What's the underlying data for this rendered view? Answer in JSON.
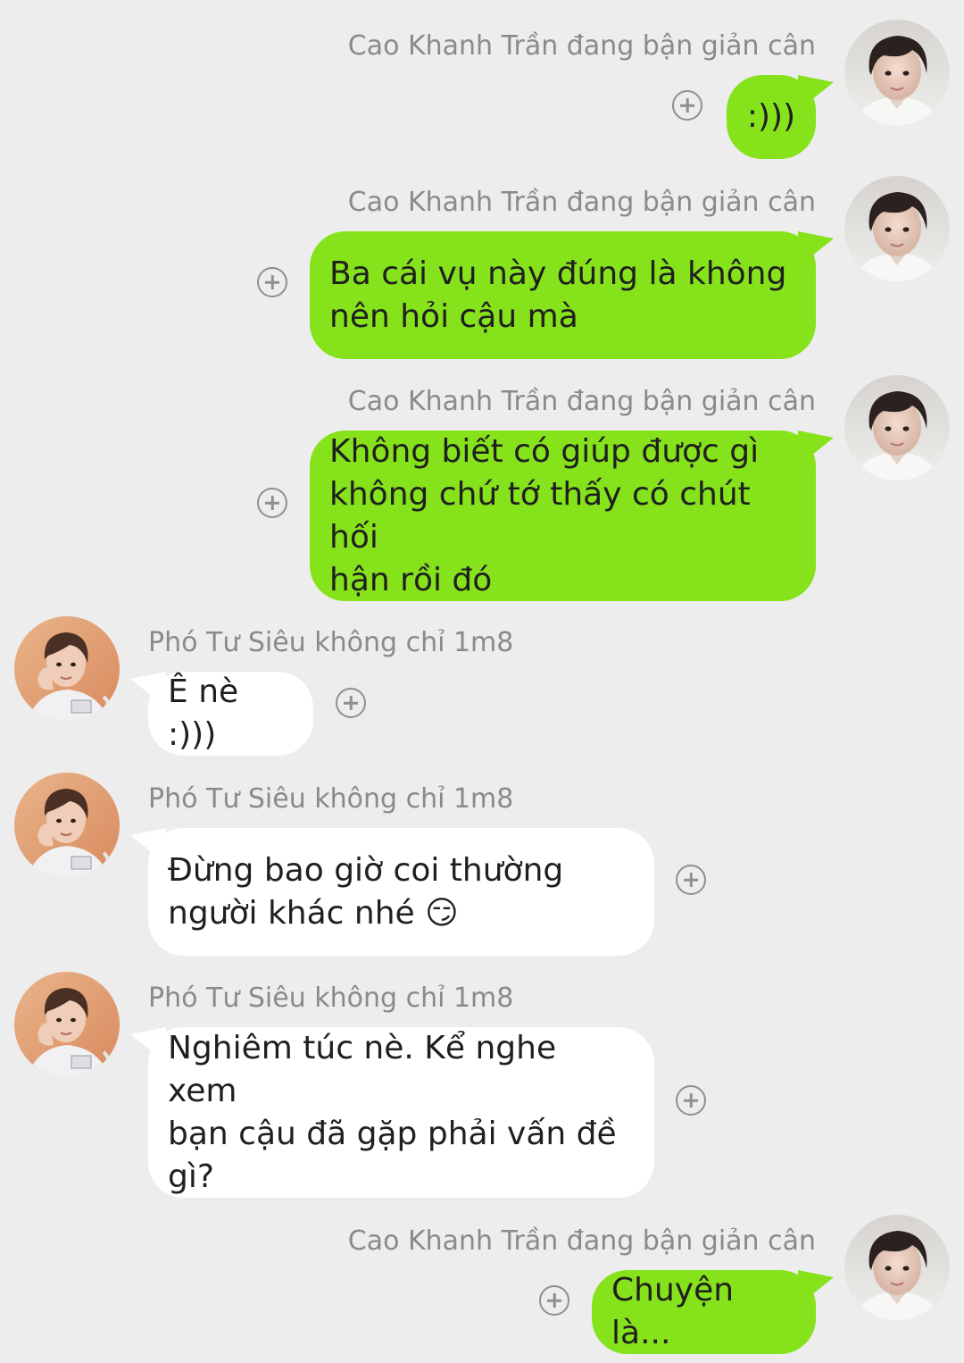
{
  "messages": [
    {
      "sender": "Cao Khanh Trần đang bận giản cân",
      "text": ":)))",
      "direction": "out",
      "avatar": "avatar-cao-khanh"
    },
    {
      "sender": "Cao Khanh Trần đang bận giản cân",
      "text": "Ba cái vụ này đúng là không\nnên hỏi cậu mà",
      "direction": "out",
      "avatar": "avatar-cao-khanh"
    },
    {
      "sender": "Cao Khanh Trần đang bận giản cân",
      "text": "Không biết có giúp được gì\nkhông chứ tớ thấy có chút hối\nhận rồi đó",
      "direction": "out",
      "avatar": "avatar-cao-khanh"
    },
    {
      "sender": "Phó Tư Siêu không chỉ 1m8",
      "text": "Ê nè :)))",
      "direction": "in",
      "avatar": "avatar-pho-tu-sieu"
    },
    {
      "sender": "Phó Tư Siêu không chỉ 1m8",
      "text": "Đừng bao giờ coi thường\nngười khác nhé 😏",
      "direction": "in",
      "avatar": "avatar-pho-tu-sieu"
    },
    {
      "sender": "Phó Tư Siêu không chỉ 1m8",
      "text": "Nghiêm túc nè. Kể nghe xem\nbạn cậu đã gặp phải vấn đề\ngì?",
      "direction": "in",
      "avatar": "avatar-pho-tu-sieu"
    },
    {
      "sender": "Cao Khanh Trần đang bận giản cân",
      "text": "Chuyện là...",
      "direction": "out",
      "avatar": "avatar-cao-khanh"
    }
  ],
  "colors": {
    "background": "#ededed",
    "outgoing_bubble": "#86e21b",
    "incoming_bubble": "#ffffff",
    "name_text": "#8a8a8a",
    "plus_icon": "#8f8f8f"
  },
  "icons": {
    "add_reaction": "plus-circle-icon"
  }
}
